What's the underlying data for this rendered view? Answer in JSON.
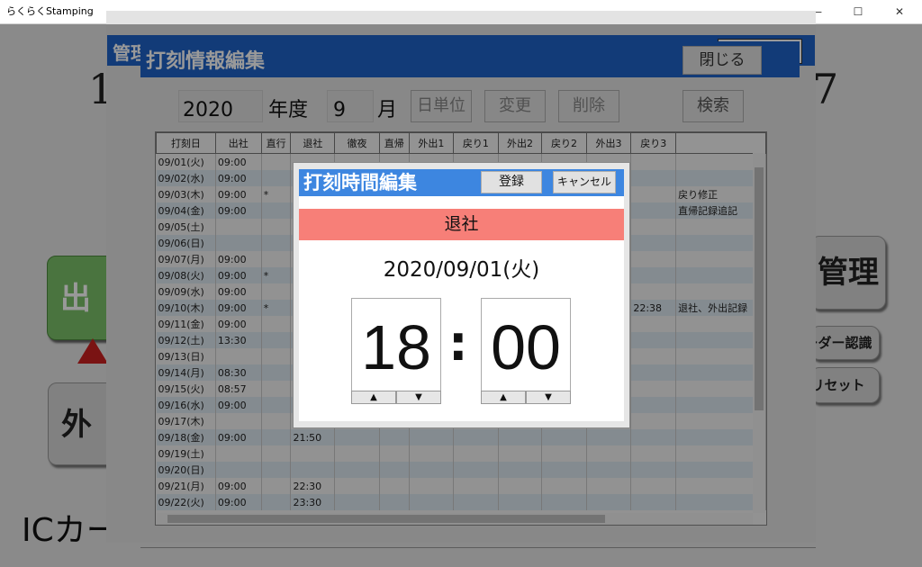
{
  "window": {
    "title": "らくらくStamping",
    "minimize_glyph": "—",
    "maximize_glyph": "☐",
    "close_glyph": "✕"
  },
  "background": {
    "left_number": "1",
    "right_number": "7",
    "header_fragment": "管理",
    "green_button": "出勤",
    "gray_button": "外出",
    "kanri_button": "管理",
    "reader_button": "リーダー認識",
    "reset_button": "リセット",
    "ic_card": "ICカード"
  },
  "panel": {
    "title": "打刻情報編集",
    "close_label": "閉じる",
    "year": "2020",
    "year_label": "年度",
    "month": "9",
    "month_label": "月",
    "buttons": {
      "daily": "日単位",
      "change": "変更",
      "delete": "削除",
      "search": "検索"
    }
  },
  "table": {
    "columns": [
      "打刻日",
      "出社",
      "直行",
      "退社",
      "徹夜",
      "直帰",
      "外出1",
      "戻り1",
      "外出2",
      "戻り2",
      "外出3",
      "戻り3",
      ""
    ],
    "rows": [
      [
        "09/01(火)",
        "09:00",
        "",
        "",
        "",
        "",
        "",
        "",
        "",
        "",
        "",
        "",
        ""
      ],
      [
        "09/02(水)",
        "09:00",
        "",
        "",
        "",
        "",
        "",
        "",
        "",
        "",
        "",
        "",
        ""
      ],
      [
        "09/03(木)",
        "09:00",
        "*",
        "",
        "",
        "",
        "",
        "",
        "",
        "",
        "",
        "",
        "戻り修正"
      ],
      [
        "09/04(金)",
        "09:00",
        "",
        "",
        "",
        "",
        "",
        "",
        "",
        "",
        "",
        "",
        "直帰記録追記"
      ],
      [
        "09/05(土)",
        "",
        "",
        "",
        "",
        "",
        "",
        "",
        "",
        "",
        "",
        "",
        ""
      ],
      [
        "09/06(日)",
        "",
        "",
        "",
        "",
        "",
        "",
        "",
        "",
        "",
        "",
        "",
        ""
      ],
      [
        "09/07(月)",
        "09:00",
        "",
        "",
        "",
        "",
        "",
        "",
        "",
        "",
        "",
        "",
        ""
      ],
      [
        "09/08(火)",
        "09:00",
        "*",
        "",
        "",
        "",
        "",
        "",
        "",
        "",
        "",
        "",
        ""
      ],
      [
        "09/09(水)",
        "09:00",
        "",
        "",
        "",
        "",
        "",
        "",
        "",
        "",
        "",
        "",
        ""
      ],
      [
        "09/10(木)",
        "09:00",
        "*",
        "",
        "",
        "",
        "",
        "",
        "",
        "",
        "",
        "22:38",
        "退社、外出記録"
      ],
      [
        "09/11(金)",
        "09:00",
        "",
        "",
        "",
        "",
        "",
        "",
        "",
        "",
        "",
        "",
        ""
      ],
      [
        "09/12(土)",
        "13:30",
        "",
        "",
        "",
        "",
        "",
        "",
        "",
        "",
        "",
        "",
        ""
      ],
      [
        "09/13(日)",
        "",
        "",
        "",
        "",
        "",
        "",
        "",
        "",
        "",
        "",
        "",
        ""
      ],
      [
        "09/14(月)",
        "08:30",
        "",
        "",
        "",
        "",
        "",
        "",
        "",
        "",
        "",
        "",
        ""
      ],
      [
        "09/15(火)",
        "08:57",
        "",
        "",
        "",
        "",
        "",
        "",
        "",
        "",
        "",
        "",
        ""
      ],
      [
        "09/16(水)",
        "09:00",
        "",
        "",
        "",
        "",
        "",
        "",
        "",
        "",
        "",
        "",
        ""
      ],
      [
        "09/17(木)",
        "",
        "",
        "",
        "",
        "",
        "",
        "",
        "",
        "",
        "",
        "",
        ""
      ],
      [
        "09/18(金)",
        "09:00",
        "",
        "21:50",
        "",
        "",
        "",
        "",
        "",
        "",
        "",
        "",
        ""
      ],
      [
        "09/19(土)",
        "",
        "",
        "",
        "",
        "",
        "",
        "",
        "",
        "",
        "",
        "",
        ""
      ],
      [
        "09/20(日)",
        "",
        "",
        "",
        "",
        "",
        "",
        "",
        "",
        "",
        "",
        "",
        ""
      ],
      [
        "09/21(月)",
        "09:00",
        "",
        "22:30",
        "",
        "",
        "",
        "",
        "",
        "",
        "",
        "",
        ""
      ],
      [
        "09/22(火)",
        "09:00",
        "",
        "23:30",
        "",
        "",
        "",
        "",
        "",
        "",
        "",
        "",
        ""
      ]
    ]
  },
  "dialog": {
    "title": "打刻時間編集",
    "register_label": "登録",
    "cancel_label": "キャンセル",
    "type_label": "退社",
    "date": "2020/09/01(火)",
    "hour": "18",
    "separator": ":",
    "minute": "00",
    "up_glyph": "▲",
    "down_glyph": "▼"
  },
  "colors": {
    "header_blue": "#1e63c8",
    "dialog_blue": "#3d86e0",
    "band_red": "#f77f78",
    "green": "#7cc16a"
  }
}
